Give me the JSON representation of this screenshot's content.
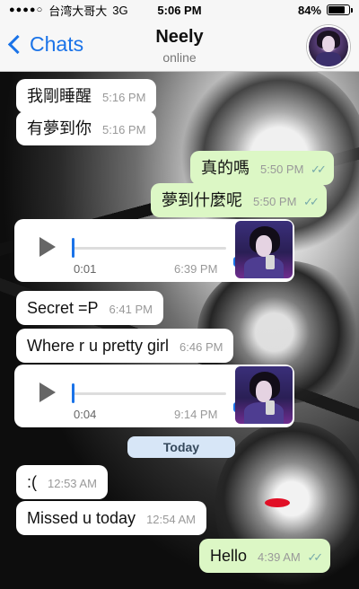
{
  "status_bar": {
    "signal_dots": "●●●●○",
    "carrier": "台湾大哥大",
    "network": "3G",
    "time": "5:06 PM",
    "battery_percent": "84%",
    "battery_level": 0.84
  },
  "header": {
    "back_label": "Chats",
    "contact_name": "Neely",
    "contact_status": "online"
  },
  "messages": [
    {
      "dir": "in",
      "type": "text",
      "text": "我剛睡醒",
      "time": "5:16 PM"
    },
    {
      "dir": "in",
      "type": "text",
      "text": "有夢到你",
      "time": "5:16 PM"
    },
    {
      "dir": "out",
      "type": "text",
      "text": "真的嗎",
      "time": "5:50 PM",
      "ticks": "✓✓"
    },
    {
      "dir": "out",
      "type": "text",
      "text": "夢到什麼呢",
      "time": "5:50 PM",
      "ticks": "✓✓"
    },
    {
      "dir": "in",
      "type": "voice",
      "duration": "0:01",
      "time": "6:39 PM"
    },
    {
      "dir": "in",
      "type": "text",
      "text": "Secret =P",
      "time": "6:41 PM"
    },
    {
      "dir": "in",
      "type": "text",
      "text": "Where r u pretty girl",
      "time": "6:46 PM"
    },
    {
      "dir": "in",
      "type": "voice",
      "duration": "0:04",
      "time": "9:14 PM"
    },
    {
      "dir": "in",
      "type": "text",
      "text": ":(",
      "time": "12:53 AM"
    },
    {
      "dir": "in",
      "type": "text",
      "text": "Missed u today",
      "time": "12:54 AM"
    },
    {
      "dir": "out",
      "type": "text",
      "text": "Hello",
      "time": "4:39 AM",
      "ticks": "✓✓"
    }
  ],
  "day_separator": "Today",
  "colors": {
    "outgoing_bubble": "#dcf7c5",
    "incoming_bubble": "#ffffff",
    "accent_blue": "#1a73e8",
    "date_pill": "#d7e6f7"
  }
}
